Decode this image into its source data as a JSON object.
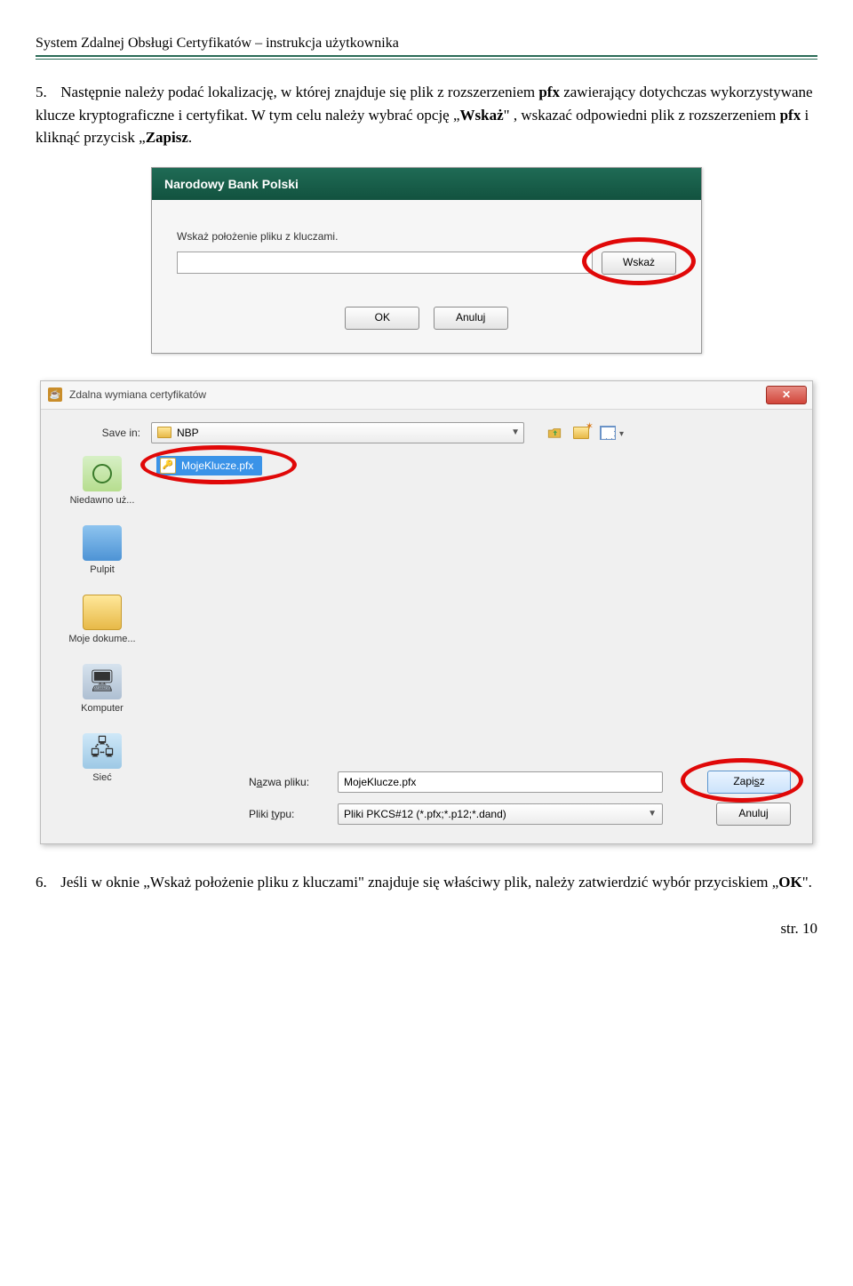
{
  "doc_header": "System Zdalnej Obsługi Certyfikatów – instrukcja użytkownika",
  "p5": {
    "num": "5.",
    "t1": "Następnie należy podać lokalizację, w której znajduje się plik z rozszerzeniem ",
    "b1": "pfx",
    "t2": " zawierający dotychczas wykorzystywane klucze kryptograficzne i certyfikat. W tym celu należy wybrać opcję „",
    "b2": "Wskaż",
    "t3": "\" , wskazać odpowiedni plik  z rozszerzeniem ",
    "b3": "pfx",
    "t4": " i kliknąć przycisk „",
    "b4": "Zapisz",
    "t5": "."
  },
  "nbp": {
    "title": "Narodowy Bank Polski",
    "label": "Wskaż położenie pliku z kluczami.",
    "btn_wskaz": "Wskaż",
    "btn_ok": "OK",
    "btn_anuluj": "Anuluj"
  },
  "save": {
    "title": "Zdalna wymiana certyfikatów",
    "savein_label": "Save in:",
    "savein_value": "NBP",
    "file_selected": "MojeKlucze.pfx",
    "places": {
      "recent": "Niedawno uż...",
      "desktop": "Pulpit",
      "docs": "Moje dokume...",
      "computer": "Komputer",
      "network": "Sieć"
    },
    "name_label_pre": "N",
    "name_label_ul": "a",
    "name_label_post": "zwa pliku:",
    "name_value": "MojeKlucze.pfx",
    "type_label_pre": "Pliki ",
    "type_label_ul": "t",
    "type_label_post": "ypu:",
    "type_value": "Pliki PKCS#12 (*.pfx;*.p12;*.dand)",
    "btn_zapisz_pre": "Zapi",
    "btn_zapisz_ul": "s",
    "btn_zapisz_post": "z",
    "btn_anuluj": "Anuluj"
  },
  "p6": {
    "num": "6.",
    "t1": "Jeśli w oknie „Wskaż położenie pliku z kluczami\" znajduje się właściwy plik, należy zatwierdzić wybór przyciskiem „",
    "b1": "OK",
    "t2": "\"."
  },
  "footer": "str. 10"
}
